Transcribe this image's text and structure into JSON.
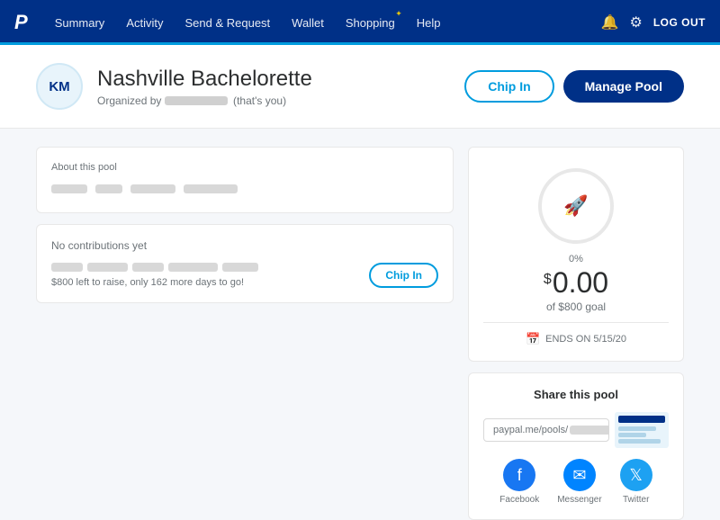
{
  "nav": {
    "logo": "P",
    "links": [
      {
        "label": "Summary",
        "id": "summary"
      },
      {
        "label": "Activity",
        "id": "activity"
      },
      {
        "label": "Send & Request",
        "id": "send-request"
      },
      {
        "label": "Wallet",
        "id": "wallet"
      },
      {
        "label": "Shopping",
        "id": "shopping",
        "hasStar": true
      },
      {
        "label": "Help",
        "id": "help"
      }
    ],
    "logout_label": "LOG OUT"
  },
  "pool": {
    "avatar_initials": "KM",
    "title": "Nashville Bachelorette",
    "organized_by": "that's you",
    "organized_prefix": "Organized by",
    "chip_in_label": "Chip In",
    "manage_pool_label": "Manage Pool"
  },
  "about_card": {
    "label": "About this pool"
  },
  "contributions_card": {
    "no_contrib_label": "No contributions yet",
    "progress_text": "$800 left to raise, only 162 more days to go!",
    "chip_in_label": "Chip In"
  },
  "progress_card": {
    "percent": "0%",
    "dollar_sign": "$",
    "amount": "0.00",
    "goal_text": "of $800 goal",
    "ends_label": "ENDS ON 5/15/20"
  },
  "share_card": {
    "title": "Share this pool",
    "link": "paypal.me/pools/",
    "social": [
      {
        "label": "Facebook",
        "id": "facebook"
      },
      {
        "label": "Messenger",
        "id": "messenger"
      },
      {
        "label": "Twitter",
        "id": "twitter"
      }
    ]
  }
}
